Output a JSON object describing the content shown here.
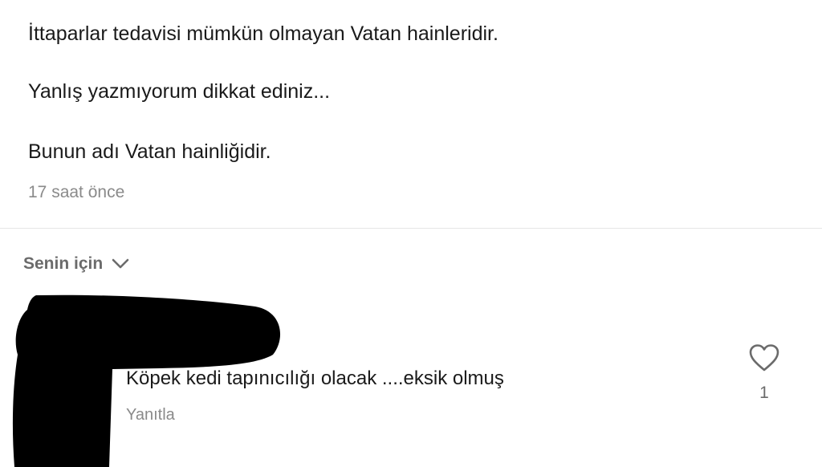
{
  "post": {
    "lines": [
      "İttaparlar tedavisi mümkün olmayan Vatan hainleridir.",
      "Yanlış yazmıyorum dikkat ediniz...",
      "Bunun adı Vatan hainliğidir."
    ],
    "timestamp": "17 saat önce"
  },
  "comments_header": {
    "sort_label": "Senin için",
    "sort_icon": "chevron-down-icon"
  },
  "comment": {
    "text": "Köpek kedi tapınıcılığı olacak ....eksik olmuş",
    "reply_label": "Yanıtla",
    "like_icon": "heart-outline-icon",
    "like_count": "1",
    "redaction_color": "#000000"
  },
  "colors": {
    "text_primary": "#1a1a1a",
    "text_secondary": "#8a8a8a",
    "divider": "#e6e6e6"
  }
}
